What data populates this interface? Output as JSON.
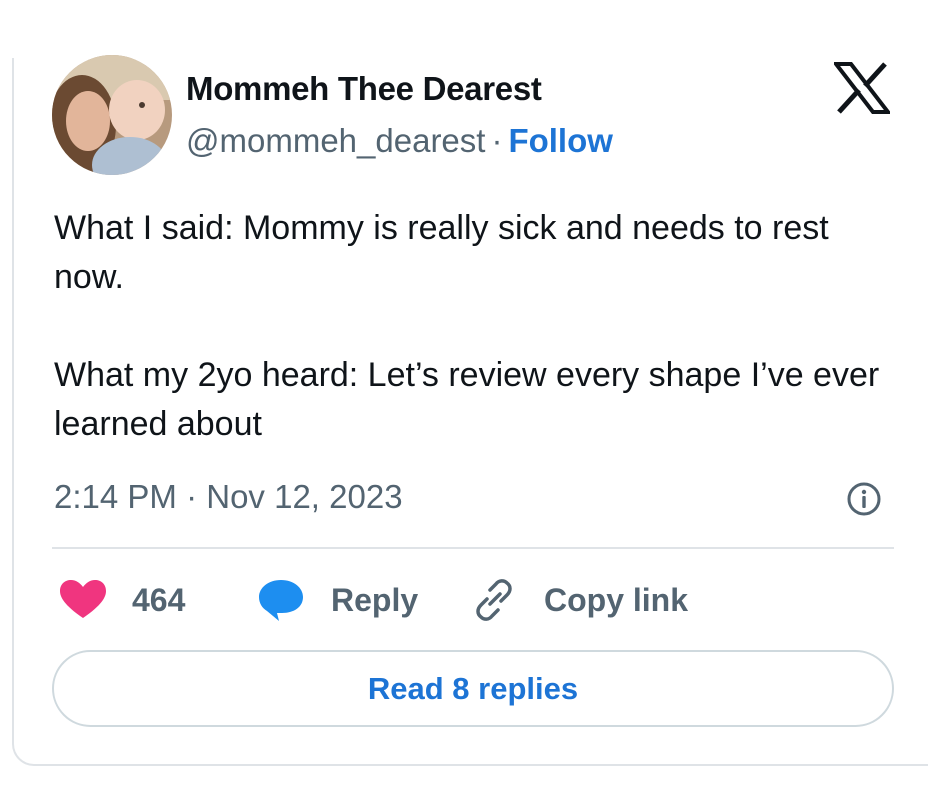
{
  "user": {
    "display_name": "Mommeh Thee Dearest",
    "handle": "@mommeh_dearest",
    "separator": "·",
    "follow_label": "Follow"
  },
  "tweet": {
    "lines": [
      "What I said: Mommy is really sick and needs to rest now.",
      "What my 2yo heard: Let’s review every shape I’ve ever learned about"
    ],
    "time": "2:14 PM",
    "date_separator": "·",
    "date": "Nov 12, 2023"
  },
  "actions": {
    "like_count": "464",
    "reply_label": "Reply",
    "copy_link_label": "Copy link"
  },
  "read_replies_label": "Read 8 replies",
  "icons": {
    "logo": "x-logo-icon",
    "info": "info-icon",
    "like": "heart-icon",
    "reply": "speech-bubble-icon",
    "copy": "link-icon"
  },
  "colors": {
    "accent": "#1d74d5",
    "heart": "#f0357f",
    "reply_bubble": "#1d8ef0",
    "secondary_text": "#536471",
    "border": "#dfe3e7"
  }
}
